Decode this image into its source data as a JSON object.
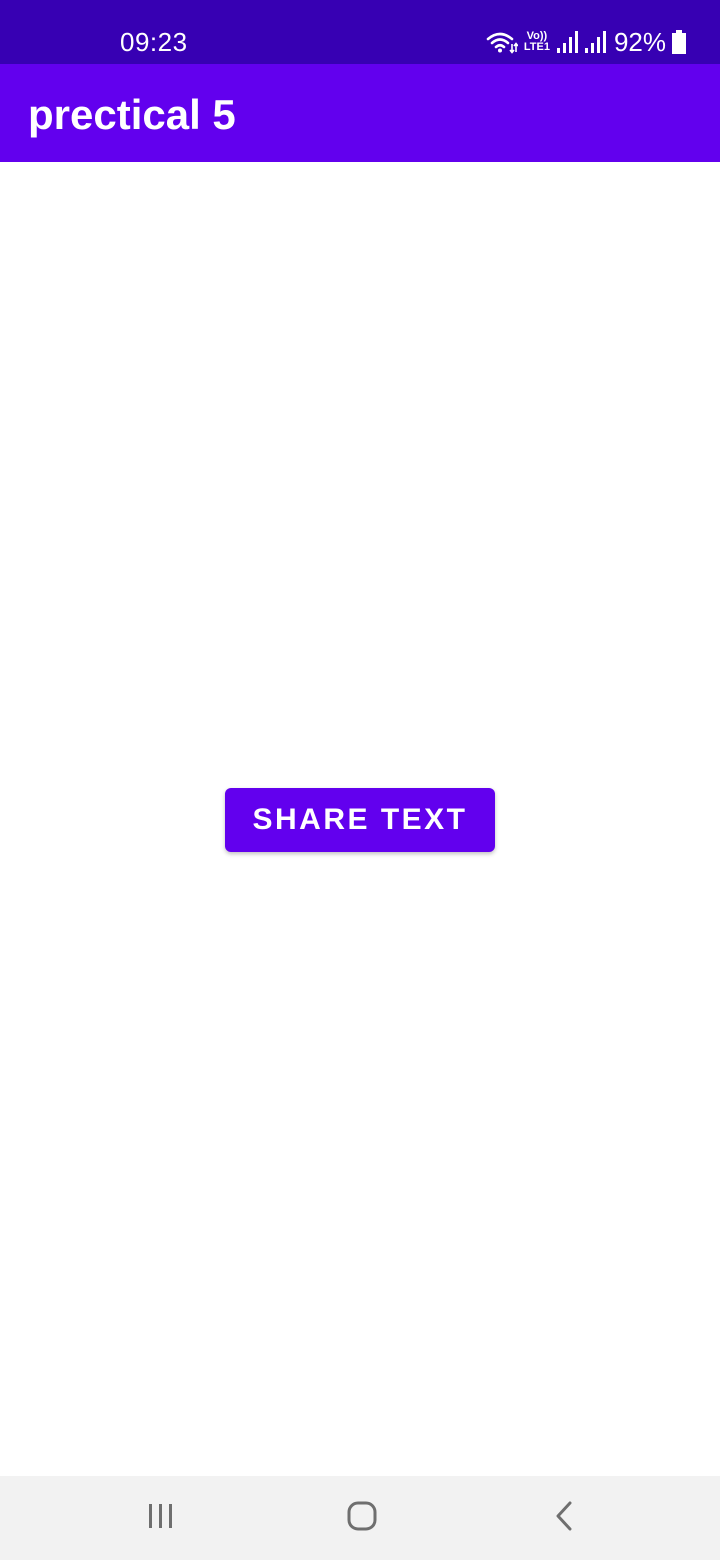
{
  "status_bar": {
    "time": "09:23",
    "lte_top": "Vo))",
    "lte_bottom": "LTE1",
    "battery_percent": "92%",
    "icons": [
      "wifi-icon",
      "lte-icon",
      "signal-icon",
      "signal-icon",
      "battery-icon"
    ],
    "background_color": "#3700B3"
  },
  "app_bar": {
    "title": "prectical 5",
    "background_color": "#6200EE"
  },
  "main": {
    "share_button_label": "SHARE TEXT",
    "button_color": "#6200EE"
  },
  "nav_bar": {
    "icons": [
      "recents-icon",
      "home-icon",
      "back-icon"
    ],
    "background_color": "#F2F2F2"
  }
}
